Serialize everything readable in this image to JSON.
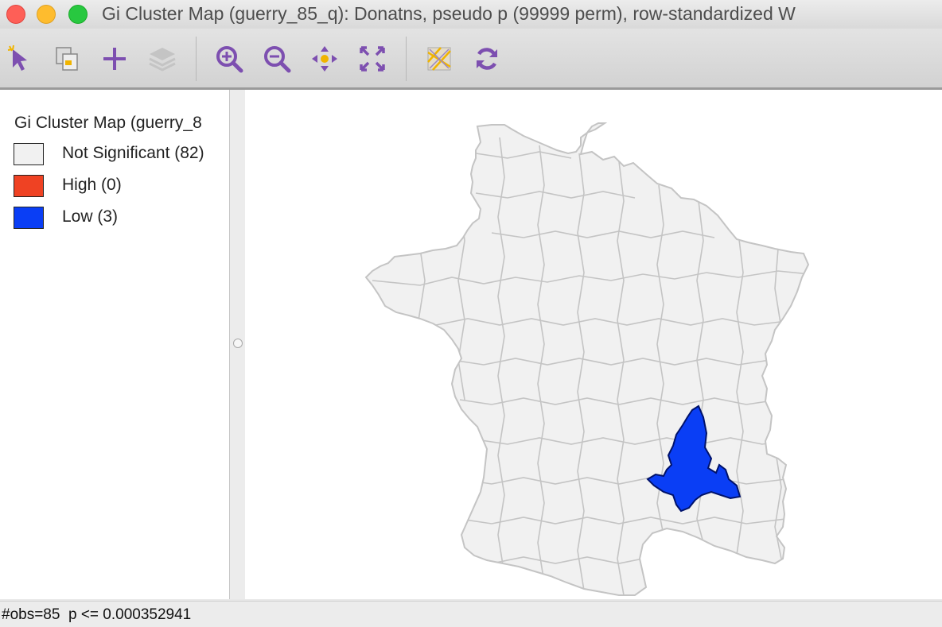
{
  "window": {
    "title": "Gi Cluster Map (guerry_85_q): Donatns, pseudo p (99999 perm), row-standardized W"
  },
  "toolbar": {
    "icons": [
      "select-arrow-icon",
      "copy-selection-icon",
      "add-icon",
      "layers-icon",
      "zoom-in-icon",
      "zoom-out-icon",
      "pan-icon",
      "full-extent-icon",
      "basemap-icon",
      "refresh-icon"
    ]
  },
  "legend": {
    "title": "Gi Cluster Map (guerry_8",
    "items": [
      {
        "label": "Not Significant (82)",
        "color": "#f1f1f1"
      },
      {
        "label": "High (0)",
        "color": "#ef4223"
      },
      {
        "label": "Low (3)",
        "color": "#0a3ef5"
      }
    ]
  },
  "map": {
    "region_fill": "#f1f1f1",
    "border_color": "#c4c4c4",
    "low_cluster_color": "#0a3ef5"
  },
  "status": {
    "text": "#obs=85  p <= 0.000352941"
  }
}
